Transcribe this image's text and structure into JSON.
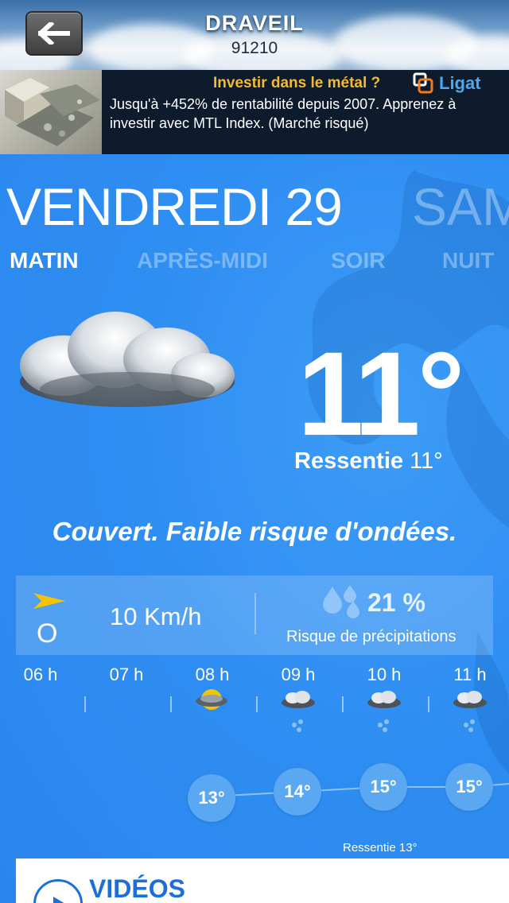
{
  "header": {
    "city": "DRAVEIL",
    "postal_code": "91210"
  },
  "ad": {
    "title": "Investir dans le métal ?",
    "body": "Jusqu'à +452% de rentabilité depuis 2007. Apprenez à investir avec MTL Index. (Marché risqué)",
    "brand": "Ligat"
  },
  "day": {
    "current": "VENDREDI 29",
    "next": "SAM"
  },
  "tabs": [
    "MATIN",
    "APRÈS-MIDI",
    "SOIR",
    "NUIT"
  ],
  "now": {
    "temperature": "11°",
    "feels_label": "Ressentie",
    "feels_value": "11°",
    "condition": "Couvert. Faible risque d'ondées."
  },
  "wind": {
    "direction": "O",
    "speed": "10 Km/h"
  },
  "precipitation": {
    "value": "21 %",
    "label": "Risque de précipitations"
  },
  "hours": [
    "06 h",
    "07 h",
    "08 h",
    "09 h",
    "10 h",
    "11 h"
  ],
  "hourly_temps": [
    "13°",
    "14°",
    "15°",
    "15°"
  ],
  "feels_small": "Ressentie 13°",
  "videos": {
    "title": "VIDÉOS"
  },
  "colors": {
    "background": "#2f8ef2",
    "accent_yellow": "#f5b935",
    "link_blue": "#1d6fd8"
  }
}
